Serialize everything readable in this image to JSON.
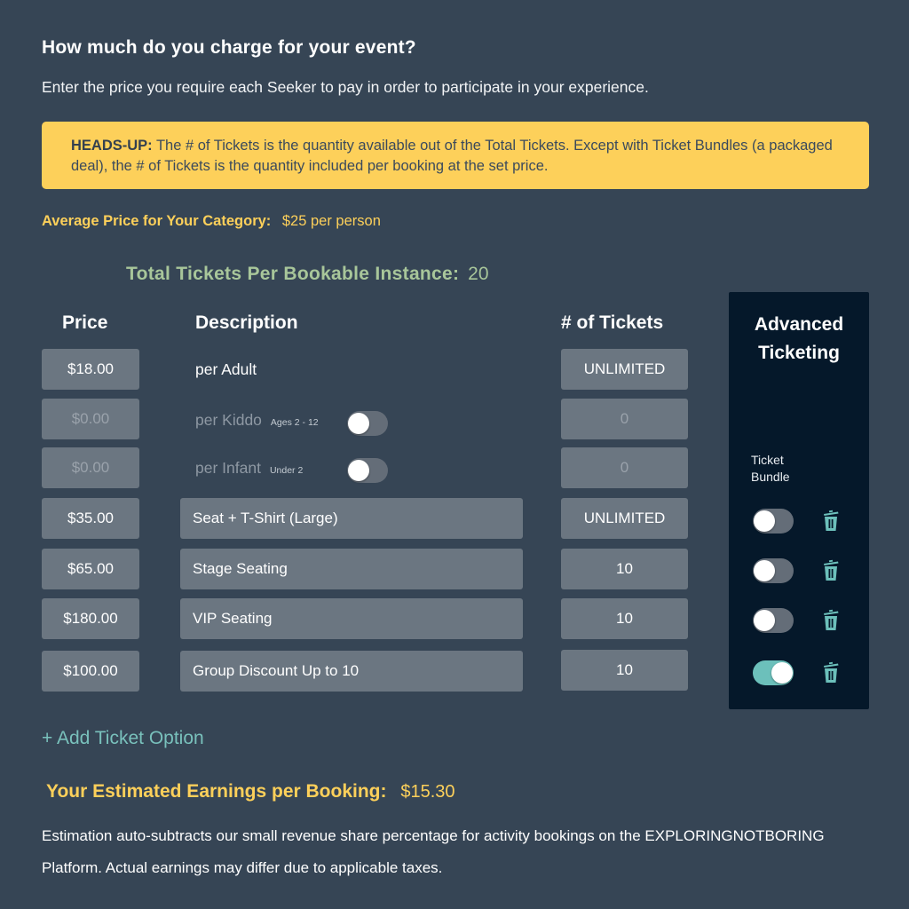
{
  "header": {
    "title": "How much do you charge for your event?",
    "subtitle": "Enter the price you require each Seeker to pay in order to participate in your experience."
  },
  "notice": {
    "label": "HEADS-UP:",
    "text": "The # of Tickets is the quantity available out of the Total Tickets. Except with Ticket Bundles (a packaged deal), the # of Tickets is the quantity included per booking at the set price."
  },
  "average": {
    "label": "Average Price for Your Category:",
    "value": "$25 per person"
  },
  "total_tickets": {
    "label": "Total Tickets Per Bookable Instance:",
    "value": "20"
  },
  "columns": {
    "price": "Price",
    "description": "Description",
    "tickets": "# of Tickets",
    "advanced": "Advanced Ticketing",
    "bundle": "Ticket Bundle"
  },
  "fixed_rows": [
    {
      "price": "$18.00",
      "description": "per Adult",
      "note": "",
      "tickets": "UNLIMITED",
      "enabled": true
    },
    {
      "price": "$0.00",
      "description": "per Kiddo",
      "note": "Ages 2 - 12",
      "tickets": "0",
      "enabled": false
    },
    {
      "price": "$0.00",
      "description": "per Infant",
      "note": "Under 2",
      "tickets": "0",
      "enabled": false
    }
  ],
  "custom_rows": [
    {
      "price": "$35.00",
      "description": "Seat + T-Shirt (Large)",
      "tickets": "UNLIMITED",
      "bundle": false
    },
    {
      "price": "$65.00",
      "description": "Stage Seating",
      "tickets": "10",
      "bundle": false
    },
    {
      "price": "$180.00",
      "description": "VIP Seating",
      "tickets": "10",
      "bundle": false
    },
    {
      "price": "$100.00",
      "description": "Group Discount Up to 10",
      "tickets": "10",
      "bundle": true
    }
  ],
  "add_option": {
    "icon": "plus-icon",
    "label": "+ Add Ticket Option"
  },
  "earnings": {
    "label": "Your Estimated Earnings per Booking:",
    "value": "$15.30",
    "note": "Estimation auto-subtracts our small revenue share percentage for activity bookings on the EXPLORINGNOTBORING Platform. Actual earnings may differ due to applicable taxes."
  },
  "colors": {
    "background": "#364555",
    "notice": "#fdd05a",
    "accent_yellow": "#fdd05a",
    "accent_green": "#a8c69a",
    "accent_teal": "#6cc0bb",
    "panel": "#05182a",
    "field": "#6b7681"
  }
}
